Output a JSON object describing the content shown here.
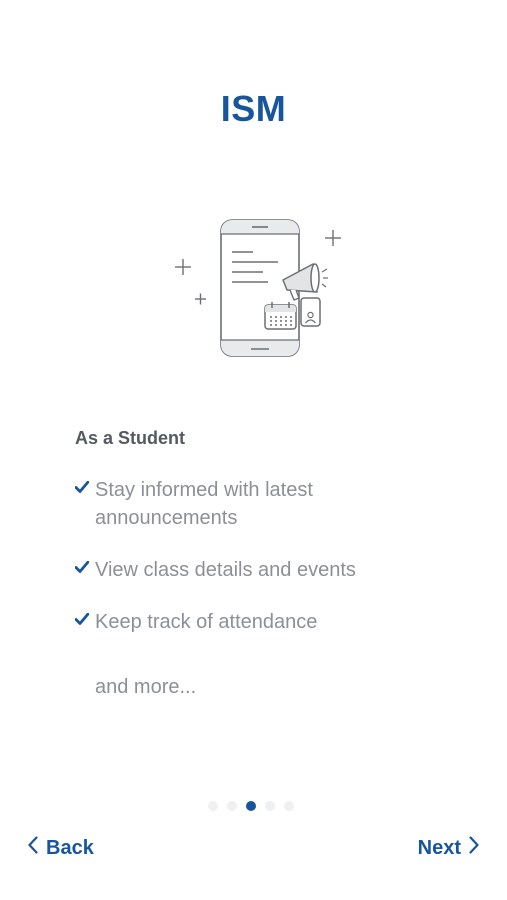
{
  "app": {
    "title": "ISM"
  },
  "onboarding": {
    "heading": "As a Student",
    "features": [
      "Stay informed with latest announcements",
      "View class details and events",
      "Keep track of attendance"
    ],
    "more": "and more...",
    "pager": {
      "total": 5,
      "current": 3
    }
  },
  "nav": {
    "back_label": "Back",
    "next_label": "Next"
  },
  "colors": {
    "accent": "#17569c",
    "text_muted": "#8c9096",
    "heading": "#555a60"
  },
  "icons": [
    "phone-illustration-icon",
    "megaphone-icon",
    "calendar-icon",
    "id-card-icon",
    "plus-icon",
    "check-icon",
    "chevron-left-icon",
    "chevron-right-icon"
  ]
}
